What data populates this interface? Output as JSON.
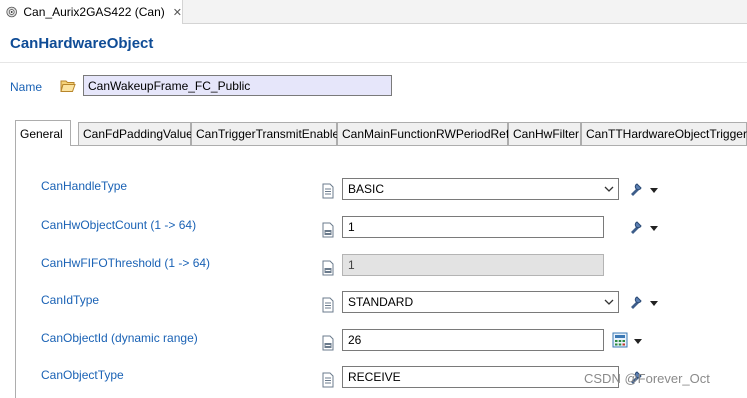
{
  "editor_tab": {
    "title": "Can_Aurix2GAS422 (Can)",
    "close": "✕"
  },
  "header": {
    "title": "CanHardwareObject"
  },
  "name_row": {
    "label": "Name",
    "value": "CanWakeupFrame_FC_Public"
  },
  "tabs": [
    {
      "label": "General"
    },
    {
      "label": "CanFdPaddingValue"
    },
    {
      "label": "CanTriggerTransmitEnable"
    },
    {
      "label": "CanMainFunctionRWPeriodRef"
    },
    {
      "label": "CanHwFilter"
    },
    {
      "label": "CanTTHardwareObjectTrigger"
    }
  ],
  "params": [
    {
      "label": "CanHandleType",
      "value": "BASIC",
      "icon": "document-icon",
      "kind": "combo"
    },
    {
      "label": "CanHwObjectCount (1 -> 64)",
      "value": "1",
      "icon": "numeric-icon",
      "kind": "text"
    },
    {
      "label": "CanHwFIFOThreshold (1 -> 64)",
      "value": "1",
      "icon": "numeric-icon",
      "kind": "disabled"
    },
    {
      "label": "CanIdType",
      "value": "STANDARD",
      "icon": "document-icon",
      "kind": "combo"
    },
    {
      "label": "CanObjectId (dynamic range)",
      "value": "26",
      "icon": "numeric-icon",
      "kind": "text"
    },
    {
      "label": "CanObjectType",
      "value": "RECEIVE",
      "icon": "document-icon",
      "kind": "combo"
    }
  ],
  "watermark": "CSDN @Forever_Oct",
  "colors": {
    "header_title": "#0f4c96",
    "param_label": "#1a62b5",
    "name_field_bg": "#e6e6fa"
  }
}
